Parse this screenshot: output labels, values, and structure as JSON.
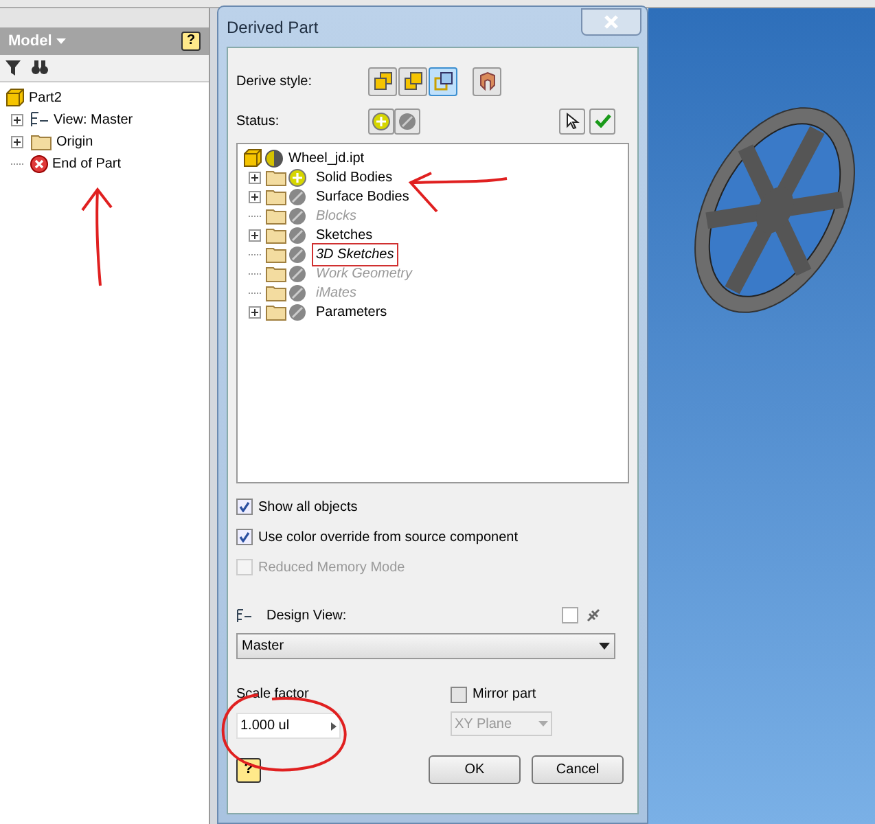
{
  "browser": {
    "title": "Model",
    "help": "?",
    "tree": [
      {
        "label": "Part2",
        "kind": "part",
        "children": [
          {
            "label": "View: Master",
            "kind": "view",
            "expandable": true
          },
          {
            "label": "Origin",
            "kind": "folder",
            "expandable": true
          },
          {
            "label": "End of Part",
            "kind": "end",
            "expandable": false
          }
        ]
      }
    ]
  },
  "dialog": {
    "title": "Derived Part",
    "derive_style": {
      "label": "Derive style:",
      "options": [
        {
          "kind": "single",
          "selected": false
        },
        {
          "kind": "separate",
          "selected": false
        },
        {
          "kind": "surface",
          "selected": true
        },
        {
          "kind": "composite",
          "selected": false
        }
      ]
    },
    "status": {
      "label": "Status:"
    },
    "tree": {
      "root": "Wheel_jd.ipt",
      "items": [
        {
          "label": "Solid Bodies",
          "kind": "include",
          "expandable": true,
          "disabled": false,
          "focused": false
        },
        {
          "label": "Surface Bodies",
          "kind": "exclude",
          "expandable": true,
          "disabled": false,
          "focused": false
        },
        {
          "label": "Blocks",
          "kind": "exclude",
          "expandable": false,
          "disabled": true,
          "focused": false
        },
        {
          "label": "Sketches",
          "kind": "exclude",
          "expandable": true,
          "disabled": false,
          "focused": false
        },
        {
          "label": "3D Sketches",
          "kind": "exclude",
          "expandable": false,
          "disabled": false,
          "focused": true
        },
        {
          "label": "Work Geometry",
          "kind": "exclude",
          "expandable": false,
          "disabled": true,
          "focused": false
        },
        {
          "label": "iMates",
          "kind": "exclude",
          "expandable": false,
          "disabled": true,
          "focused": false
        },
        {
          "label": "Parameters",
          "kind": "exclude",
          "expandable": true,
          "disabled": false,
          "focused": false
        }
      ]
    },
    "options": [
      {
        "label": "Show all objects",
        "checked": true,
        "disabled": false
      },
      {
        "label": "Use color override from source component",
        "checked": true,
        "disabled": false
      },
      {
        "label": "Reduced Memory Mode",
        "checked": false,
        "disabled": true
      }
    ],
    "design_view": {
      "label": "Design View:",
      "associative": false,
      "value": "Master"
    },
    "scale_factor": {
      "label": "Scale factor",
      "value": "1.000 ul"
    },
    "mirror": {
      "label": "Mirror part",
      "checked": false,
      "plane": "XY Plane",
      "plane_disabled": true
    },
    "help": "?",
    "buttons": [
      "OK",
      "Cancel"
    ]
  }
}
